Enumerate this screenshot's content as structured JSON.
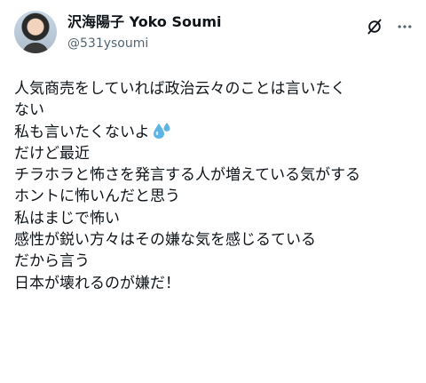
{
  "post": {
    "display_name": "沢海陽子 Yoko Soumi",
    "handle": "@531ysoumi",
    "lines": [
      "人気商売をしていれば政治云々のことは言いたく",
      "ない",
      "私も言いたくないよ",
      "だけど最近",
      "チラホラと怖さを発言する人が増えている気がする",
      "ホントに怖いんだと思う",
      "私はまじで怖い",
      "感性が鋭い方々はその嫌な気を感じるている",
      "だから言う",
      "日本が壊れるのが嫌だ！"
    ],
    "emoji": "sweat-droplets-icon",
    "icons": {
      "grok": "grok-icon",
      "more": "more-options-icon"
    }
  },
  "colors": {
    "text_primary": "#0f1419",
    "text_secondary": "#536471",
    "emoji_blue": "#5fb4e6"
  }
}
